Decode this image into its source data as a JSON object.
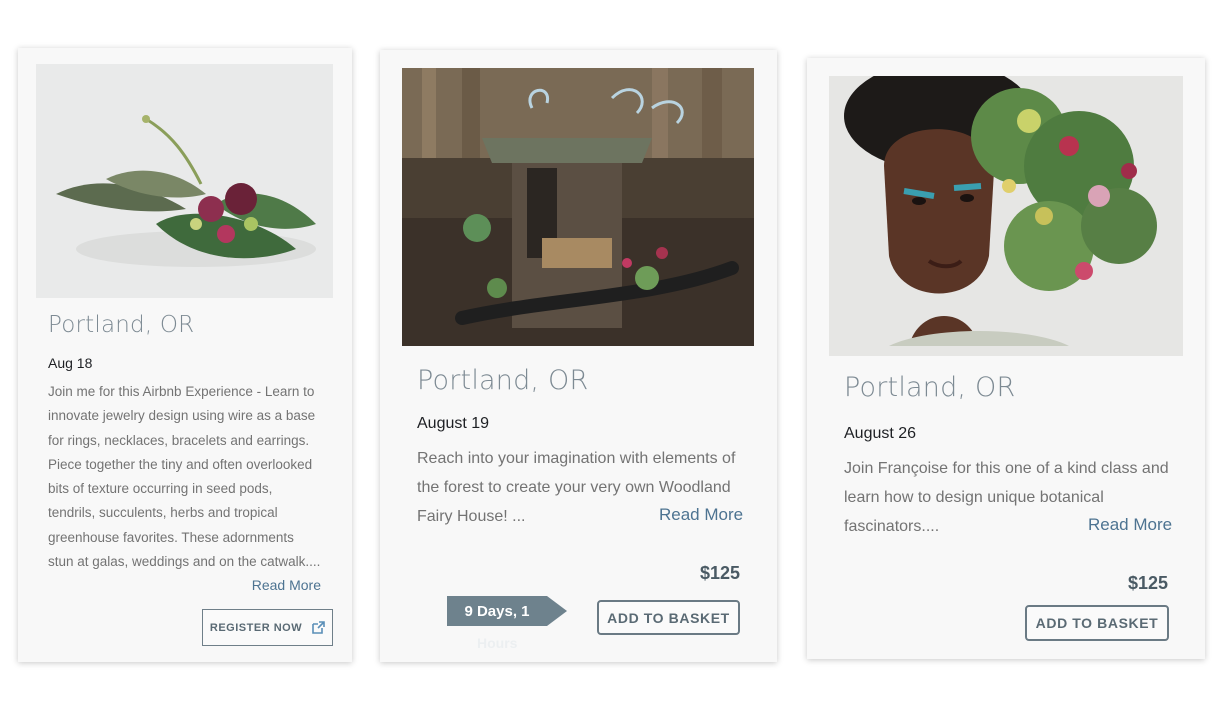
{
  "cards": [
    {
      "city": "Portland, OR",
      "date": "Aug 18",
      "description": "Join me for this Airbnb Experience - Learn to innovate jewelry design using wire as a base for rings, necklaces, bracelets and earrings. Piece together the tiny and often overlooked bits of texture occurring in seed pods, tendrils, succulents, herbs and tropical greenhouse favorites. These adornments stun at galas, weddings and on the catwalk....",
      "read_more": "Read More",
      "register_label": "REGISTER NOW",
      "image_icon": "floral-arrangement-image"
    },
    {
      "city": "Portland, OR",
      "date": "August 19",
      "description": "Reach into your imagination with elements of the forest to create your very own Woodland Fairy House! ...",
      "read_more": "Read More",
      "price": "$125",
      "basket_label": "ADD TO BASKET",
      "countdown": "9 Days, 1",
      "countdown_overflow": "Hours",
      "image_icon": "fairy-house-image"
    },
    {
      "city": "Portland, OR",
      "date": "August 26",
      "description": "Join Françoise for this one of a kind class and learn how to design unique botanical fascinators....",
      "read_more": "Read More",
      "price": "$125",
      "basket_label": "ADD TO BASKET",
      "image_icon": "botanical-headpiece-image"
    }
  ],
  "colors": {
    "accent": "#4d7391",
    "button_border": "#6a7a84",
    "countdown_bg": "#6e828d",
    "card_bg": "#f8f8f8"
  }
}
